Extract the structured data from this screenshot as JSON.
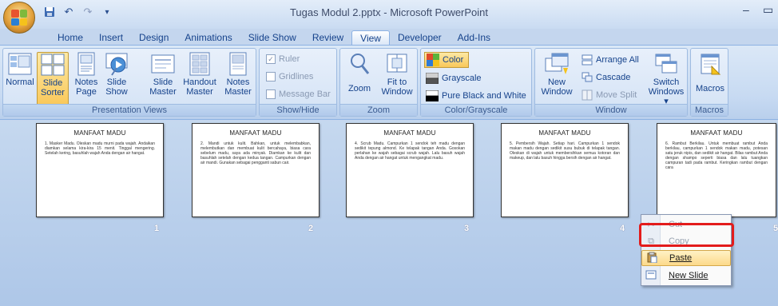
{
  "app": {
    "title": "Tugas Modul 2.pptx - Microsoft PowerPoint",
    "win_minimize": "–",
    "win_restore": "▭"
  },
  "qat": {
    "save_icon": "save-icon",
    "undo_icon": "undo-icon",
    "redo_icon": "redo-icon",
    "more_icon": "customize-qat-icon"
  },
  "tabs": [
    {
      "label": "Home"
    },
    {
      "label": "Insert"
    },
    {
      "label": "Design"
    },
    {
      "label": "Animations"
    },
    {
      "label": "Slide Show"
    },
    {
      "label": "Review"
    },
    {
      "label": "View",
      "active": true
    },
    {
      "label": "Developer"
    },
    {
      "label": "Add-Ins"
    }
  ],
  "ribbon": {
    "presentation_views": {
      "label": "Presentation Views",
      "normal": "Normal",
      "slide_sorter_1": "Slide",
      "slide_sorter_2": "Sorter",
      "notes_page_1": "Notes",
      "notes_page_2": "Page",
      "slide_show_1": "Slide",
      "slide_show_2": "Show",
      "slide_master_1": "Slide",
      "slide_master_2": "Master",
      "handout_master_1": "Handout",
      "handout_master_2": "Master",
      "notes_master_1": "Notes",
      "notes_master_2": "Master"
    },
    "show_hide": {
      "label": "Show/Hide",
      "ruler": "Ruler",
      "gridlines": "Gridlines",
      "message_bar": "Message Bar"
    },
    "zoom": {
      "label": "Zoom",
      "zoom": "Zoom",
      "fit_1": "Fit to",
      "fit_2": "Window"
    },
    "color": {
      "label": "Color/Grayscale",
      "color": "Color",
      "grayscale": "Grayscale",
      "pure_bw": "Pure Black and White"
    },
    "window": {
      "label": "Window",
      "new_1": "New",
      "new_2": "Window",
      "arrange_all": "Arrange All",
      "cascade": "Cascade",
      "move_split": "Move Split",
      "switch_1": "Switch",
      "switch_2": "Windows ▾"
    },
    "macros": {
      "label": "Macros",
      "macros": "Macros"
    }
  },
  "slides": [
    {
      "number": "1",
      "title": "MANFAAT MADU",
      "body": "1. Masker Madu. Oleskan madu murni pada wajah. Andaikan diamkan selama kira-kira 15 menit. Tinggal mengering. Setelah kering, basuhlah wajah Anda dengan air hangat."
    },
    {
      "number": "2",
      "title": "MANFAAT MADU",
      "body": "2. Mandi untuk kulit. Bahkan, untuk melembabkan, melembutkan dan membuat kulit bercahaya, biasa cara sebelum madu, saya ada minyak. Diamkan ke kulit dan basuhlah setelah dengan kedua tangan. Campurkan dengan air mandi. Gunakan sebagai pengganti sabun cair."
    },
    {
      "number": "3",
      "title": "MANFAAT MADU",
      "body": "4. Scrub Madu. Campurkan 1 sendok teh madu dengan sedikit tepung almond. Ke telapak tangan Anda. Gosokan perlahan ke wajah sebagai scrub wajah. Lalu basuh wajah Anda dengan air hangat untuk mengangkat madu."
    },
    {
      "number": "4",
      "title": "MANFAAT MADU",
      "body": "5. Pembersih Wajah. Setiap hari. Campurkan 1 sendok makan madu dengan sedikit susu bubuk di telapak tangan. Oleskan di wajah untuk membersihkan semua kotoran dan makeup, dan lalu basuh hingga bersih dengan air hangat."
    },
    {
      "number": "5",
      "title": "MANFAAT MADU",
      "body": "6. Rambut Berkilau. Untuk membuat rambut Anda berkilau, campurkan 1 sendok makan madu, potesan satu jeruk nipis, dan sedikit air hangat. Bilas rambut Anda dengan shampo seperti biasa dan lalu tuangkan campuran tadi pada rambut. Keringkan rambut dengan cara"
    }
  ],
  "context_menu": {
    "cut": "Cut",
    "cut_icon": "scissors-icon",
    "copy": "Copy",
    "copy_icon": "copy-icon",
    "paste": "Paste",
    "paste_icon": "clipboard-paste-icon",
    "new_slide": "New Slide",
    "new_slide_icon": "new-slide-icon"
  },
  "colors": {
    "accent": "#15428b",
    "highlight_box": "#e31b1b",
    "selected_button": "#f9c85a"
  }
}
